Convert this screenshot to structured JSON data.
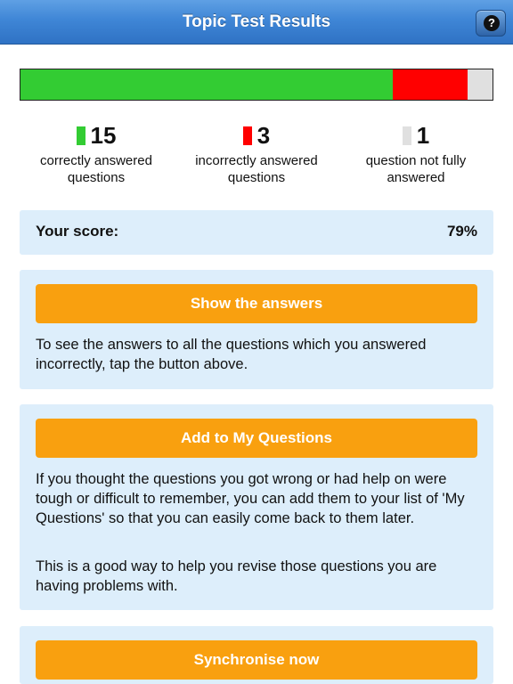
{
  "header": {
    "title": "Topic Test Results",
    "help_icon_glyph": "?"
  },
  "progress": {
    "segments": [
      {
        "name": "correct",
        "count": 15,
        "color": "#33cc33"
      },
      {
        "name": "incorrect",
        "count": 3,
        "color": "#ff0000"
      },
      {
        "name": "not_answered",
        "count": 1,
        "color": "#e0e0e0"
      }
    ]
  },
  "stats": {
    "correct": {
      "count": "15",
      "label": "correctly answered questions",
      "color": "#33cc33"
    },
    "incorrect": {
      "count": "3",
      "label": "incorrectly answered questions",
      "color": "#ff0000"
    },
    "unanswered": {
      "count": "1",
      "label": "question not fully answered",
      "color": "#e0e0e0"
    }
  },
  "score": {
    "label": "Your score:",
    "value": "79%"
  },
  "answers_panel": {
    "button_label": "Show the answers",
    "text": "To see the answers to all the questions which you answered incorrectly, tap the button above."
  },
  "myquestions_panel": {
    "button_label": "Add to My Questions",
    "text1": "If you thought the questions you got wrong or had help on were tough or difficult to remember, you can add them to your list of 'My Questions' so that you can easily come back to them later.",
    "text2": "This is a good way to help you revise those questions you are having problems with."
  },
  "sync_panel": {
    "button_label": "Synchronise now"
  },
  "colors": {
    "accent": "#f9a00f",
    "panel_bg": "#ddeefb",
    "header": "#3f86d6"
  }
}
